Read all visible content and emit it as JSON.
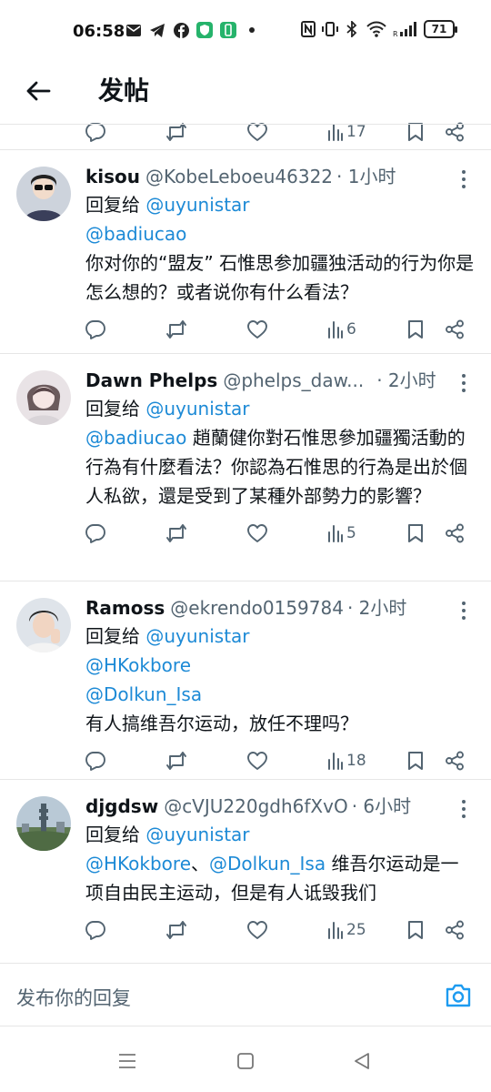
{
  "status_bar": {
    "time": "06:58",
    "battery": "71"
  },
  "header": {
    "title": "发帖"
  },
  "partial_actions": {
    "views": "17"
  },
  "posts": [
    {
      "name": "kisou",
      "handle": "@KobeLeboeu46322",
      "time": "· 1小时",
      "reply_prefix": "回复给",
      "reply_to": "@uyunistar",
      "mentions": "@badiucao",
      "text": "你对你的“盟友” 石惟思参加疆独活动的行为你是怎么想的？或者说你有什么看法？",
      "views": "6"
    },
    {
      "name": "Dawn Phelps",
      "handle": "@phelps_daw...",
      "time": "· 2小时",
      "reply_prefix": "回复给",
      "reply_to": "@uyunistar",
      "mentions": "@badiucao",
      "text": " 趙蘭健你對石惟思參加疆獨活動的行為有什麼看法？你認為石惟思的行為是出於個人私欲，還是受到了某種外部勢力的影響？",
      "views": "5"
    },
    {
      "name": "Ramoss",
      "handle": "@ekrendo0159784",
      "time": "· 2小时",
      "reply_prefix": "回复给",
      "reply_to": "@uyunistar",
      "mention1": "@HKokbore",
      "mention2": "@Dolkun_Isa",
      "text": "有人搞维吾尔运动，放任不理吗？",
      "views": "18"
    },
    {
      "name": "djgdsw",
      "handle": "@cVJU220gdh6fXvO",
      "time": "· 6小时",
      "reply_prefix": "回复给",
      "reply_to": "@uyunistar",
      "mention1": "@HKokbore",
      "separator": "、",
      "mention2": "@Dolkun_Isa",
      "text": " 维吾尔运动是一项自由民主运动，但是有人诋毁我们",
      "views": "25"
    }
  ],
  "reply_box": {
    "placeholder": "发布你的回复"
  },
  "colors": {
    "link": "#1d8ad6",
    "secondary_text": "#536471",
    "divider": "#e6e6e6"
  }
}
